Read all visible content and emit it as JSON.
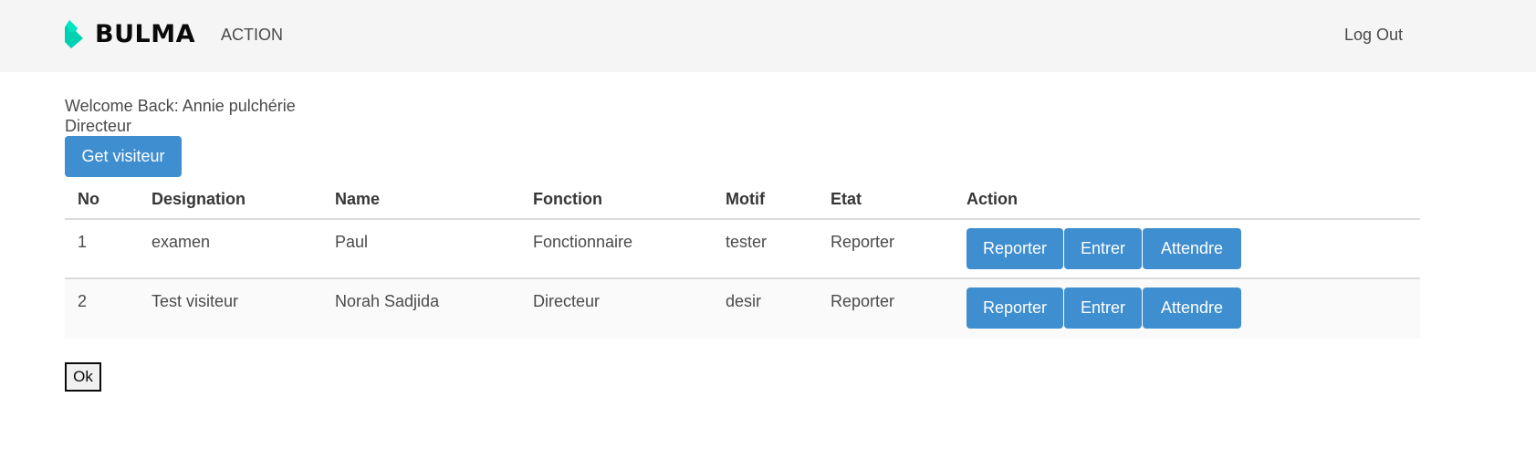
{
  "navbar": {
    "brand": "BULMA",
    "brand_logo": "bulma-logo-icon",
    "action_label": "ACTION",
    "logout_label": "Log Out"
  },
  "user": {
    "welcome": "Welcome Back: Annie pulchérie",
    "role": "Directeur"
  },
  "get_button": "Get visiteur",
  "table": {
    "headers": [
      "No",
      "Designation",
      "Name",
      "Fonction",
      "Motif",
      "Etat",
      "Action"
    ],
    "rows": [
      {
        "no": "1",
        "designation": "examen",
        "name": "Paul",
        "fonction": "Fonctionnaire",
        "motif": "tester",
        "etat": "Reporter"
      },
      {
        "no": "2",
        "designation": "Test visiteur",
        "name": "Norah Sadjida",
        "fonction": "Directeur",
        "motif": "desir",
        "etat": "Reporter"
      }
    ],
    "row_actions": [
      "Reporter",
      "Entrer",
      "Attendre"
    ]
  },
  "ok_button": "Ok",
  "colors": {
    "primary": "#3e8ed0",
    "brand": "#00d1b2",
    "navbar_bg": "#f5f5f5"
  }
}
